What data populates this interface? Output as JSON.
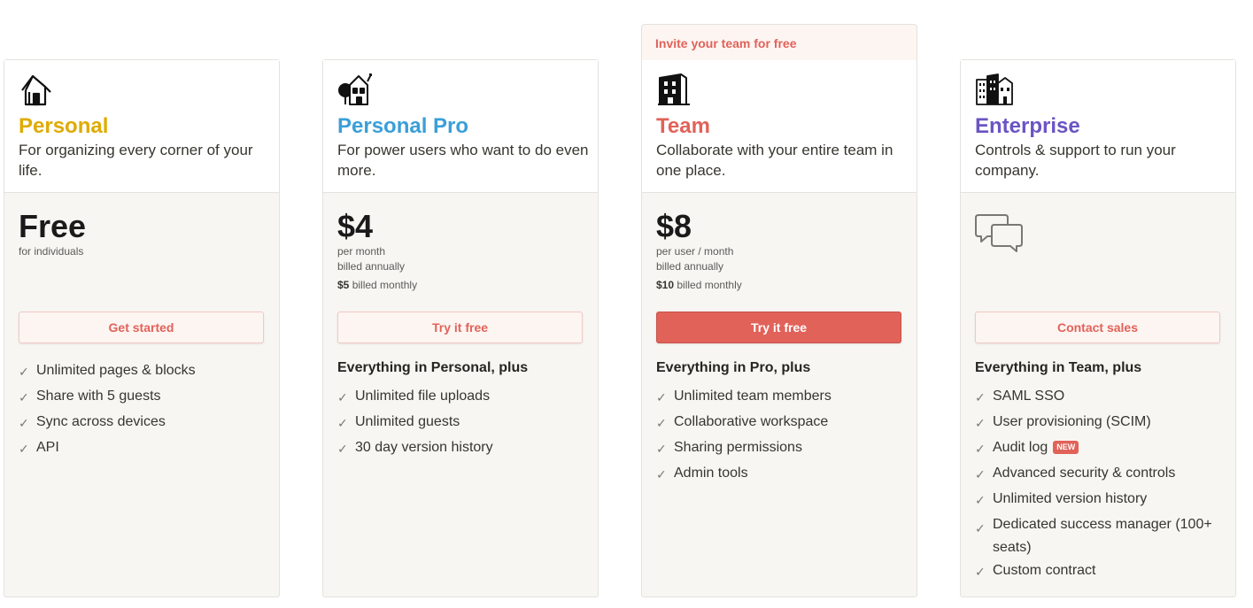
{
  "plans": [
    {
      "name": "Personal",
      "color": "#dfab01",
      "icon": "house-icon",
      "description": "For organizing every corner of your life.",
      "price": "Free",
      "price_note": "for individuals",
      "button": "Get started",
      "features": [
        "Unlimited pages & blocks",
        "Share with 5 guests",
        "Sync across devices",
        "API"
      ]
    },
    {
      "name": "Personal Pro",
      "color": "#3a9fd8",
      "icon": "house-tree-icon",
      "description": "For power users who want to do even more.",
      "price": "$4",
      "price_note": "per month",
      "billing": "billed annually",
      "monthly_price": "$5",
      "monthly_label": "billed monthly",
      "button": "Try it free",
      "plus_heading": "Everything in Personal, plus",
      "features": [
        "Unlimited file uploads",
        "Unlimited guests",
        "30 day version history"
      ]
    },
    {
      "name": "Team",
      "color": "#e16259",
      "icon": "building-icon",
      "banner": "Invite your team for free",
      "description": "Collaborate with your entire team in one place.",
      "price": "$8",
      "price_note": "per user / month",
      "billing": "billed annually",
      "monthly_price": "$10",
      "monthly_label": "billed monthly",
      "button": "Try it free",
      "plus_heading": "Everything in Pro, plus",
      "features": [
        "Unlimited team members",
        "Collaborative workspace",
        "Sharing permissions",
        "Admin tools"
      ]
    },
    {
      "name": "Enterprise",
      "color": "#6b54c4",
      "icon": "city-icon",
      "description": "Controls & support to run your company.",
      "price_icon": "chat-bubbles-icon",
      "button": "Contact sales",
      "plus_heading": "Everything in Team, plus",
      "features": [
        "SAML SSO",
        "User provisioning (SCIM)",
        "Audit log",
        "Advanced security & controls",
        "Unlimited version history",
        "Dedicated success manager (100+ seats)",
        "Custom contract"
      ],
      "new_badge": "NEW"
    }
  ],
  "check_glyph": "✓"
}
